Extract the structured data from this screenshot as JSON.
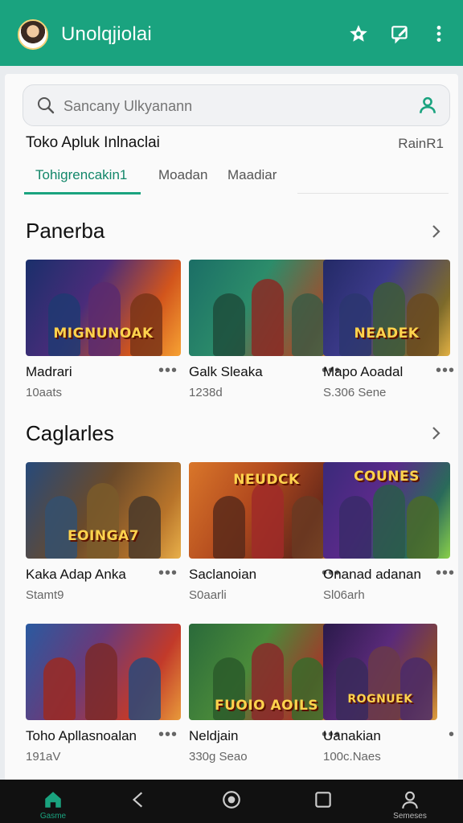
{
  "app": {
    "title": "Unolqjiolai"
  },
  "search": {
    "placeholder": "Sancany Ulkyanann"
  },
  "subheading": {
    "left": "Toko Apluk Inlnaclai",
    "right": "RainR1"
  },
  "tabs": [
    {
      "label": "Tohigrencakin1",
      "active": true
    },
    {
      "label": "Moadan",
      "active": false
    },
    {
      "label": "Maadiar",
      "active": false
    }
  ],
  "sections": [
    {
      "title": "Panerba",
      "games": [
        {
          "name": "Madrari",
          "meta": "10aats",
          "logo": "MIGNUNOAK"
        },
        {
          "name": "Galk Sleaka",
          "meta": "1238d",
          "logo": ""
        },
        {
          "name": "Mapo Aoadal",
          "meta": "S.306 Sene",
          "logo": "NEADEK"
        }
      ]
    },
    {
      "title": "Caglarles",
      "games": [
        {
          "name": "Kaka Adap Anka",
          "meta": "Stamt9",
          "logo": "EOINGA7"
        },
        {
          "name": "Saclanoian",
          "meta": "S0aarli",
          "logo": "NEUDCK"
        },
        {
          "name": "Onanad adanan",
          "meta": "Sl06arh",
          "logo": "COUNES"
        }
      ]
    },
    {
      "title": "",
      "games": [
        {
          "name": "Toho Apllasnoalan",
          "meta": "191aV",
          "logo": ""
        },
        {
          "name": "Neldjain",
          "meta": "330g Seao",
          "logo": "FUOIO AOILS"
        },
        {
          "name": "Uanakian",
          "meta": "100c.Naes",
          "logo": "ROGNUEK"
        }
      ]
    }
  ],
  "bottom_nav": {
    "home_label": "Gasme",
    "profile_label": "Semeses"
  },
  "colors": {
    "accent": "#1aa37f",
    "topbar": "#1aa37f",
    "navbar": "#111111"
  }
}
